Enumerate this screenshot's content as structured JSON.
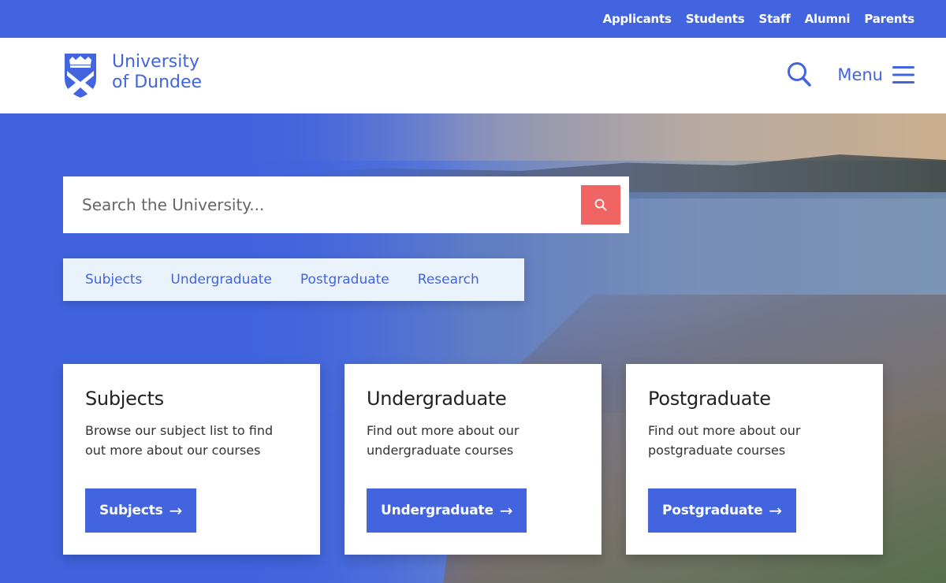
{
  "utility_nav": [
    "Applicants",
    "Students",
    "Staff",
    "Alumni",
    "Parents"
  ],
  "header": {
    "logo_line1": "University",
    "logo_line2": "of Dundee",
    "menu_label": "Menu"
  },
  "search": {
    "placeholder": "Search the University..."
  },
  "quick_links": [
    "Subjects",
    "Undergraduate",
    "Postgraduate",
    "Research"
  ],
  "cards": [
    {
      "title": "Subjects",
      "description": "Browse our subject list to find out more about our courses",
      "button": "Subjects",
      "arrow": "→"
    },
    {
      "title": "Undergraduate",
      "description": "Find out more about our undergraduate courses",
      "button": "Undergraduate",
      "arrow": "→"
    },
    {
      "title": "Postgraduate",
      "description": "Find out more about our postgraduate courses",
      "button": "Postgraduate",
      "arrow": "→"
    }
  ],
  "colors": {
    "brand_blue": "#4264de",
    "search_button": "#f06464",
    "quick_links_bg": "#eaf3fb"
  },
  "icons": {
    "crest": "university-crest-icon",
    "search": "search-icon",
    "menu": "hamburger-menu-icon",
    "arrow": "arrow-right-icon"
  }
}
